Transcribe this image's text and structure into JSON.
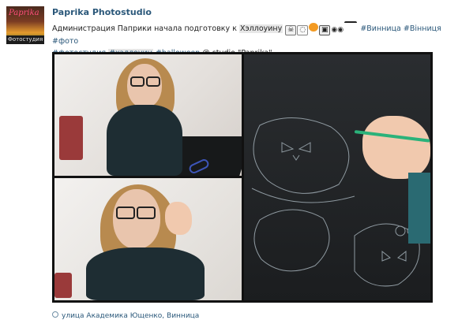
{
  "author": {
    "name": "Paprika Photostudio",
    "avatar": {
      "brand_text": "Paprika",
      "caption": "Фотостудия"
    }
  },
  "post": {
    "line1": {
      "text_before": "Администрация Паприки начала подготовку к ",
      "highlight": "Хэллоуину",
      "emoji": [
        "skull-icon",
        "ghost-icon",
        "jack-o-lantern-icon",
        "vampire-icon",
        "eyes-icon",
        "glasses-icon"
      ],
      "tags": [
        "#Винница",
        "#Вінниця",
        "#фото"
      ]
    },
    "line2": {
      "tags_before": [
        "#фотостудия"
      ],
      "highlight_tag": "#хэллоуин",
      "tags_after": [
        "#halloween"
      ],
      "place_text": " @ studio \"Paprika\""
    }
  },
  "location": {
    "icon": "map-pin-icon",
    "text": "улица Академика Ющенко, Винница"
  },
  "colors": {
    "link": "#2b587a",
    "highlight": "#e7e7e7",
    "photo_border": "#111111"
  }
}
